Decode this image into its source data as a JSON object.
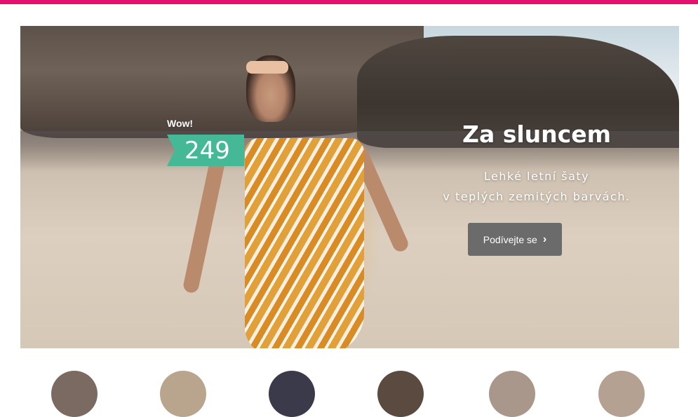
{
  "hero": {
    "badge_label": "Wow!",
    "price": "249",
    "headline": "Za sluncem",
    "subtitle_line1": "Lehké letní šaty",
    "subtitle_line2": "v teplých zemitých barvách.",
    "cta_label": "Podívejte se",
    "cta_icon": "chevron-right-icon"
  },
  "colors": {
    "top_bar": "#e3106f",
    "price_tag": "#45b896",
    "cta_bg": "#6b6b6b"
  },
  "thumbnails": [
    {
      "name": "category-thumb-1"
    },
    {
      "name": "category-thumb-2"
    },
    {
      "name": "category-thumb-3"
    },
    {
      "name": "category-thumb-4"
    },
    {
      "name": "category-thumb-5"
    },
    {
      "name": "category-thumb-6"
    }
  ]
}
